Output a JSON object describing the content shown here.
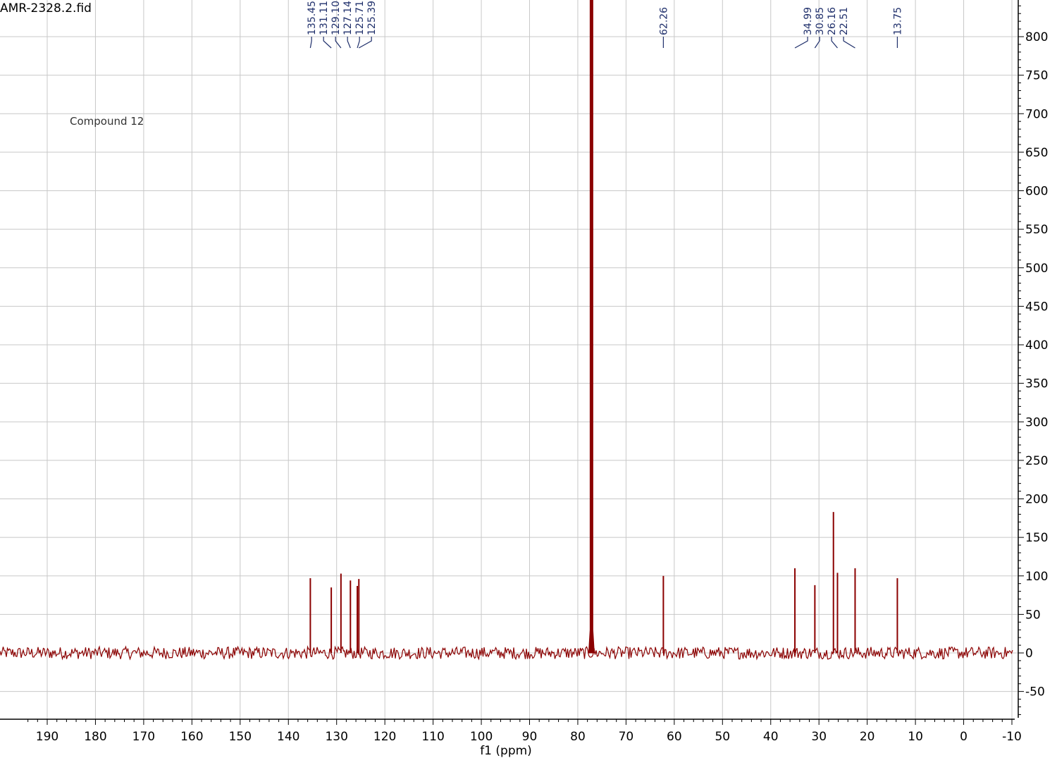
{
  "file_title": "AMR-2328.2.fid",
  "annotation": "Compound 12",
  "chart_data": {
    "type": "line",
    "title": "AMR-2328.2.fid",
    "xlabel": "f1 (ppm)",
    "ylabel": "",
    "x_reversed": true,
    "xlim": [
      195,
      -10
    ],
    "ylim": [
      -80,
      840
    ],
    "grid": true,
    "x_ticks": [
      190,
      180,
      170,
      160,
      150,
      140,
      130,
      120,
      110,
      100,
      90,
      80,
      70,
      60,
      50,
      40,
      30,
      20,
      10,
      0,
      -10
    ],
    "y_ticks": [
      -50,
      0,
      50,
      100,
      150,
      200,
      250,
      300,
      350,
      400,
      450,
      500,
      550,
      600,
      650,
      700,
      750,
      800
    ],
    "baseline_noise_amplitude": 8,
    "series": [
      {
        "color": "#8b0000",
        "peaks": [
          {
            "ppm": 135.45,
            "height": 97
          },
          {
            "ppm": 131.11,
            "height": 85
          },
          {
            "ppm": 129.1,
            "height": 103
          },
          {
            "ppm": 127.14,
            "height": 94
          },
          {
            "ppm": 125.71,
            "height": 87
          },
          {
            "ppm": 125.39,
            "height": 96
          },
          {
            "ppm": 77.16,
            "height": 840
          },
          {
            "ppm": 62.26,
            "height": 100
          },
          {
            "ppm": 34.99,
            "height": 110
          },
          {
            "ppm": 30.85,
            "height": 88
          },
          {
            "ppm": 27.0,
            "height": 183
          },
          {
            "ppm": 26.16,
            "height": 104
          },
          {
            "ppm": 22.51,
            "height": 110
          },
          {
            "ppm": 13.75,
            "height": 97
          }
        ]
      }
    ],
    "peak_label_groups": [
      [
        "135.45",
        "131.11",
        "129.10",
        "127.14",
        "125.71",
        "125.39"
      ],
      [
        "62.26"
      ],
      [
        "34.99",
        "30.85",
        "26.16",
        "22.51"
      ],
      [
        "13.75"
      ]
    ],
    "peak_label_color": "#1f2f6b"
  }
}
